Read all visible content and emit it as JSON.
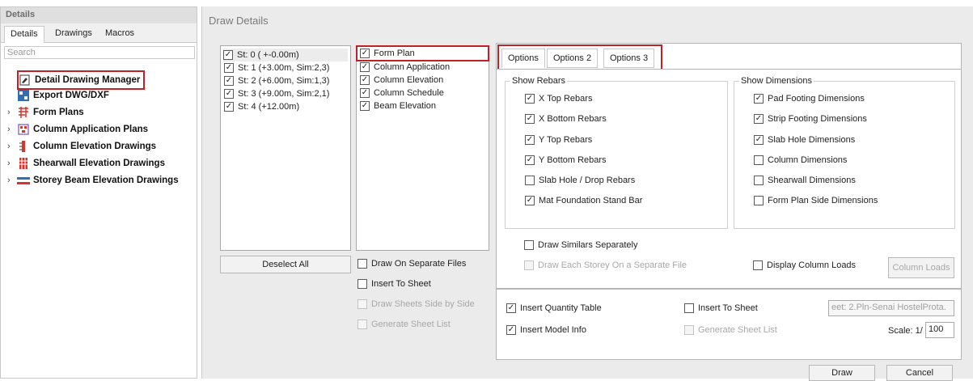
{
  "left_panel": {
    "title": "Details",
    "tabs": [
      "Details",
      "Drawings",
      "Macros"
    ],
    "search_placeholder": "Search",
    "tree": [
      {
        "label": "Detail Drawing Manager",
        "icon": "drawing-manager-icon",
        "expandable": false
      },
      {
        "label": "Export DWG/DXF",
        "icon": "export-icon",
        "expandable": false
      },
      {
        "label": "Form Plans",
        "icon": "form-plan-icon",
        "expandable": true
      },
      {
        "label": "Column Application Plans",
        "icon": "column-application-icon",
        "expandable": true
      },
      {
        "label": "Column Elevation Drawings",
        "icon": "column-elevation-icon",
        "expandable": true
      },
      {
        "label": "Shearwall Elevation Drawings",
        "icon": "shearwall-icon",
        "expandable": true
      },
      {
        "label": "Storey Beam Elevation Drawings",
        "icon": "beam-elevation-icon",
        "expandable": true
      }
    ]
  },
  "main": {
    "title": "Draw Details",
    "storeys": [
      {
        "label": "St: 0 ( +-0.00m)",
        "checked": true
      },
      {
        "label": "St: 1 (+3.00m, Sim:2,3)",
        "checked": true
      },
      {
        "label": "St: 2 (+6.00m, Sim:1,3)",
        "checked": true
      },
      {
        "label": "St: 3 (+9.00m, Sim:2,1)",
        "checked": true
      },
      {
        "label": "St: 4 (+12.00m)",
        "checked": true
      }
    ],
    "drawing_types": [
      {
        "label": "Form Plan",
        "checked": true
      },
      {
        "label": "Column Application",
        "checked": true
      },
      {
        "label": "Column Elevation",
        "checked": true
      },
      {
        "label": "Column Schedule",
        "checked": true
      },
      {
        "label": "Beam Elevation",
        "checked": true
      }
    ],
    "deselect_all": "Deselect All",
    "mid_options": [
      {
        "label": "Draw On Separate Files",
        "checked": false,
        "disabled": false
      },
      {
        "label": "Insert To Sheet",
        "checked": false,
        "disabled": false
      },
      {
        "label": "Draw Sheets Side by Side",
        "checked": false,
        "disabled": true
      },
      {
        "label": "Generate Sheet List",
        "checked": false,
        "disabled": true
      }
    ]
  },
  "options": {
    "tabs": [
      "Options",
      "Options 2",
      "Options 3"
    ],
    "show_rebars_title": "Show Rebars",
    "show_rebars": [
      {
        "label": "X Top Rebars",
        "checked": true
      },
      {
        "label": "X Bottom Rebars",
        "checked": true
      },
      {
        "label": "Y Top Rebars",
        "checked": true
      },
      {
        "label": "Y Bottom Rebars",
        "checked": true
      },
      {
        "label": "Slab Hole / Drop Rebars",
        "checked": false
      },
      {
        "label": "Mat Foundation Stand Bar",
        "checked": true
      }
    ],
    "show_dimensions_title": "Show Dimensions",
    "show_dimensions": [
      {
        "label": "Pad Footing Dimensions",
        "checked": true
      },
      {
        "label": "Strip Footing Dimensions",
        "checked": true
      },
      {
        "label": "Slab Hole Dimensions",
        "checked": true
      },
      {
        "label": "Column Dimensions",
        "checked": false
      },
      {
        "label": "Shearwall Dimensions",
        "checked": false
      },
      {
        "label": "Form Plan Side Dimensions",
        "checked": false
      }
    ],
    "draw_similars": {
      "label": "Draw Similars Separately",
      "checked": false
    },
    "draw_each_storey": {
      "label": "Draw Each Storey On a Separate File",
      "checked": false
    },
    "display_column_loads": {
      "label": "Display Column Loads",
      "checked": false
    },
    "column_loads_button": "Column Loads"
  },
  "footer": {
    "insert_quantity_table": {
      "label": "Insert Quantity Table",
      "checked": true
    },
    "insert_model_info": {
      "label": "Insert Model Info",
      "checked": true
    },
    "insert_to_sheet": {
      "label": "Insert To Sheet",
      "checked": false
    },
    "generate_sheet_list": {
      "label": "Generate Sheet List",
      "checked": false
    },
    "sheet_value": "eet: 2.Pln-Senai HostelProta.",
    "scale_label": "Scale: 1/",
    "scale_value": "100",
    "draw_button": "Draw",
    "cancel_button": "Cancel"
  }
}
